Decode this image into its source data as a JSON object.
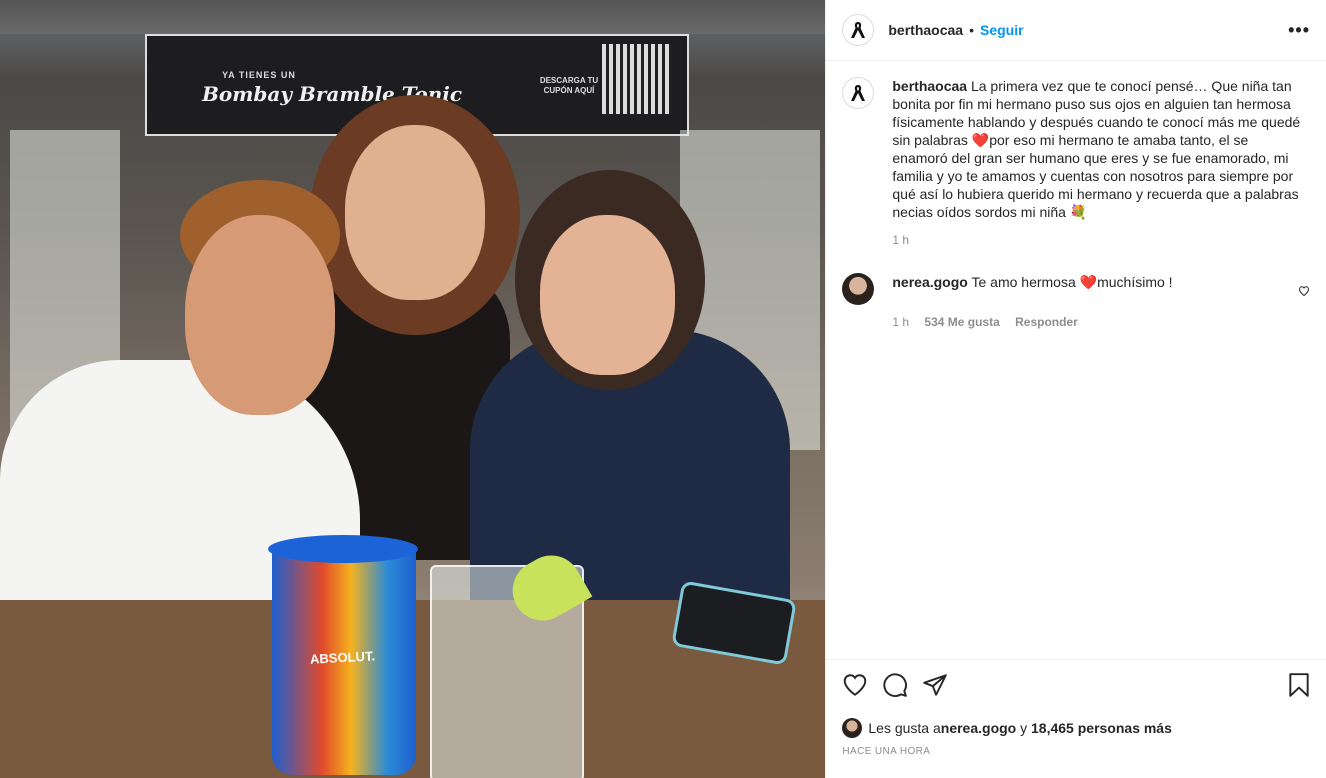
{
  "post": {
    "username": "berthaocaa",
    "follow_label": "Seguir",
    "separator": "•",
    "more_label": "•••"
  },
  "photo": {
    "sign_line1": "YA TIENES UN",
    "sign_line2": "Bombay Bramble Tonic",
    "sign_line3": "DESCARGA TU CUPÓN AQUÍ",
    "cup_brand": "ABSOLUT."
  },
  "caption": {
    "username": "berthaocaa",
    "part1": "La primera vez que te conocí pensé… Que niña tan bonita por fin mi hermano puso sus ojos en alguien tan hermosa físicamente hablando y después cuando te conocí más me quedé sin palabras ",
    "emoji1": "❤️",
    "part2": "por eso mi hermano te amaba tanto, el se enamoró del gran ser humano que eres y se fue enamorado, mi familia y yo te amamos y cuentas con nosotros para siempre por qué así lo hubiera querido mi hermano y recuerda que a palabras necias oídos sordos mi niña ",
    "emoji2": "💐",
    "time": "1 h"
  },
  "comment": {
    "username": "nerea.gogo",
    "text_a": "Te amo hermosa ",
    "emoji": "❤️",
    "text_b": "muchísimo !",
    "time": "1 h",
    "likes": "534 Me gusta",
    "reply_label": "Responder"
  },
  "likes": {
    "prefix": "Les gusta a ",
    "user": "nerea.gogo",
    "middle": " y ",
    "count": "18,465 personas más"
  },
  "posted_ago": "HACE UNA HORA",
  "icons": [
    "heart-icon",
    "comment-icon",
    "share-icon",
    "bookmark-icon",
    "more-icon",
    "ribbon-icon"
  ]
}
